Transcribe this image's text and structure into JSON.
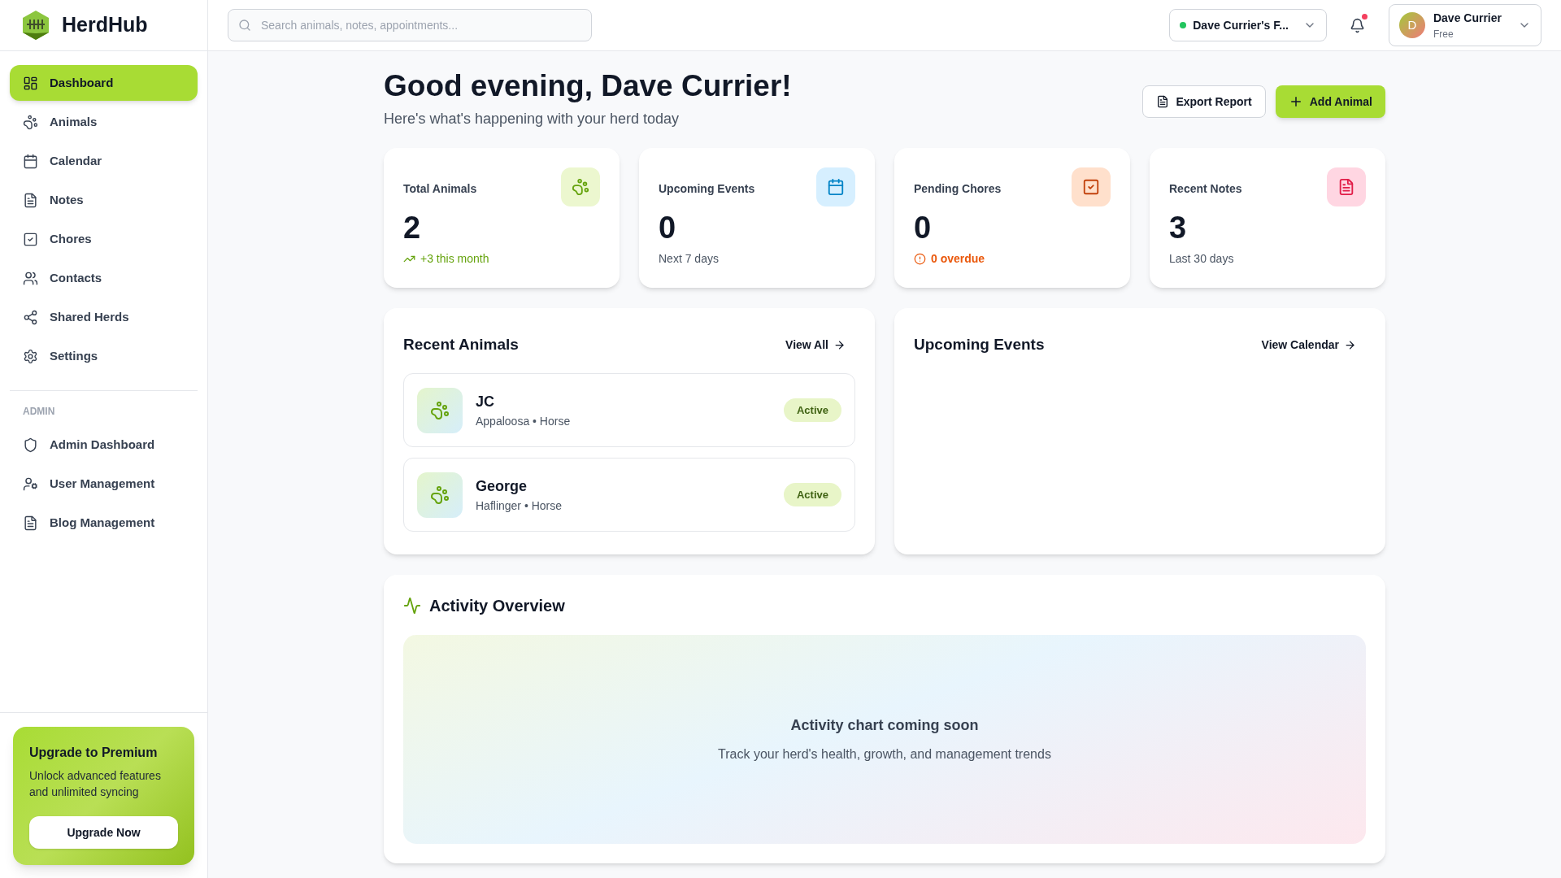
{
  "brand": {
    "name": "HerdHub"
  },
  "nav": {
    "items": [
      {
        "label": "Dashboard",
        "selected": true
      },
      {
        "label": "Animals",
        "selected": false
      },
      {
        "label": "Calendar",
        "selected": false
      },
      {
        "label": "Notes",
        "selected": false
      },
      {
        "label": "Chores",
        "selected": false
      },
      {
        "label": "Contacts",
        "selected": false
      },
      {
        "label": "Shared Herds",
        "selected": false
      },
      {
        "label": "Settings",
        "selected": false
      }
    ],
    "admin_heading": "ADMIN",
    "admin_items": [
      {
        "label": "Admin Dashboard",
        "selected": false
      },
      {
        "label": "User Management",
        "selected": false
      },
      {
        "label": "Blog Management",
        "selected": false
      }
    ]
  },
  "upgrade": {
    "title": "Upgrade to Premium",
    "text": "Unlock advanced features and unlimited syncing",
    "button": "Upgrade Now"
  },
  "topbar": {
    "search": {
      "placeholder": "Search animals, notes, appointments..."
    },
    "farm": {
      "name": "Dave Currier's F...",
      "color": "#22c55e"
    },
    "notifications": {
      "unread": true
    },
    "user": {
      "initial": "D",
      "name": "Dave Currier",
      "plan": "Free"
    }
  },
  "header": {
    "greeting": "Good evening, Dave Currier!",
    "subtitle": "Here's what's happening with your herd today",
    "buttons": [
      {
        "label": "Export Report",
        "kind": "secondary"
      },
      {
        "label": "Add Animal",
        "kind": "primary"
      }
    ]
  },
  "stats": [
    {
      "kind": "animals",
      "label": "Total Animals",
      "value": "2",
      "note": {
        "text": "+3 this month",
        "kind": "trend"
      }
    },
    {
      "kind": "events",
      "label": "Upcoming Events",
      "value": "0",
      "note": {
        "text": "Next 7 days",
        "kind": "plain"
      }
    },
    {
      "kind": "chores",
      "label": "Pending Chores",
      "value": "0",
      "note": {
        "text": "0 overdue",
        "kind": "alert"
      }
    },
    {
      "kind": "notes",
      "label": "Recent Notes",
      "value": "3",
      "note": {
        "text": "Last 30 days",
        "kind": "plain"
      }
    }
  ],
  "recent_animals": {
    "title": "Recent Animals",
    "link": "View All",
    "rows": [
      {
        "name": "JC",
        "details": "Appaloosa • Horse",
        "status": "Active"
      },
      {
        "name": "George",
        "details": "Haflinger • Horse",
        "status": "Active"
      }
    ]
  },
  "upcoming_events": {
    "title": "Upcoming Events",
    "link": "View Calendar"
  },
  "activity": {
    "title": "Activity Overview",
    "placeholder_title": "Activity chart coming soon",
    "placeholder_text": "Track your herd's health, growth, and management trends"
  }
}
